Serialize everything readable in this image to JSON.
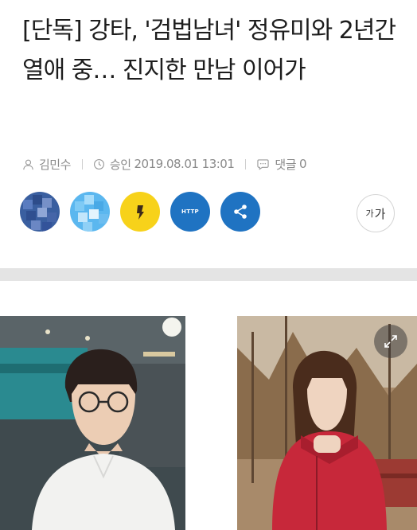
{
  "article": {
    "headline": "[단독] 강타, '검법남녀' 정유미와 2년간 열애 중… 진지한 만남 이어가",
    "author": "김민수",
    "approved_label": "승인",
    "approved_datetime": "2019.08.01 13:01",
    "comments_label": "댓글",
    "comments_count": "0"
  },
  "share": {
    "http_label": "HTTP",
    "buttons": [
      "facebook-share (blurred)",
      "twitter-share (blurred)",
      "kakaostory-share",
      "copy-url",
      "share"
    ]
  },
  "font_size_button": {
    "small_label": "가",
    "large_label": "가"
  },
  "colors": {
    "kakao": "#f7d21a",
    "share_blue": "#1f73c2",
    "meta_text": "#8a8a8a",
    "divider": "#e4e4e4"
  },
  "icons": [
    "user-icon",
    "clock-icon",
    "comment-icon",
    "share-icon",
    "expand-icon"
  ]
}
